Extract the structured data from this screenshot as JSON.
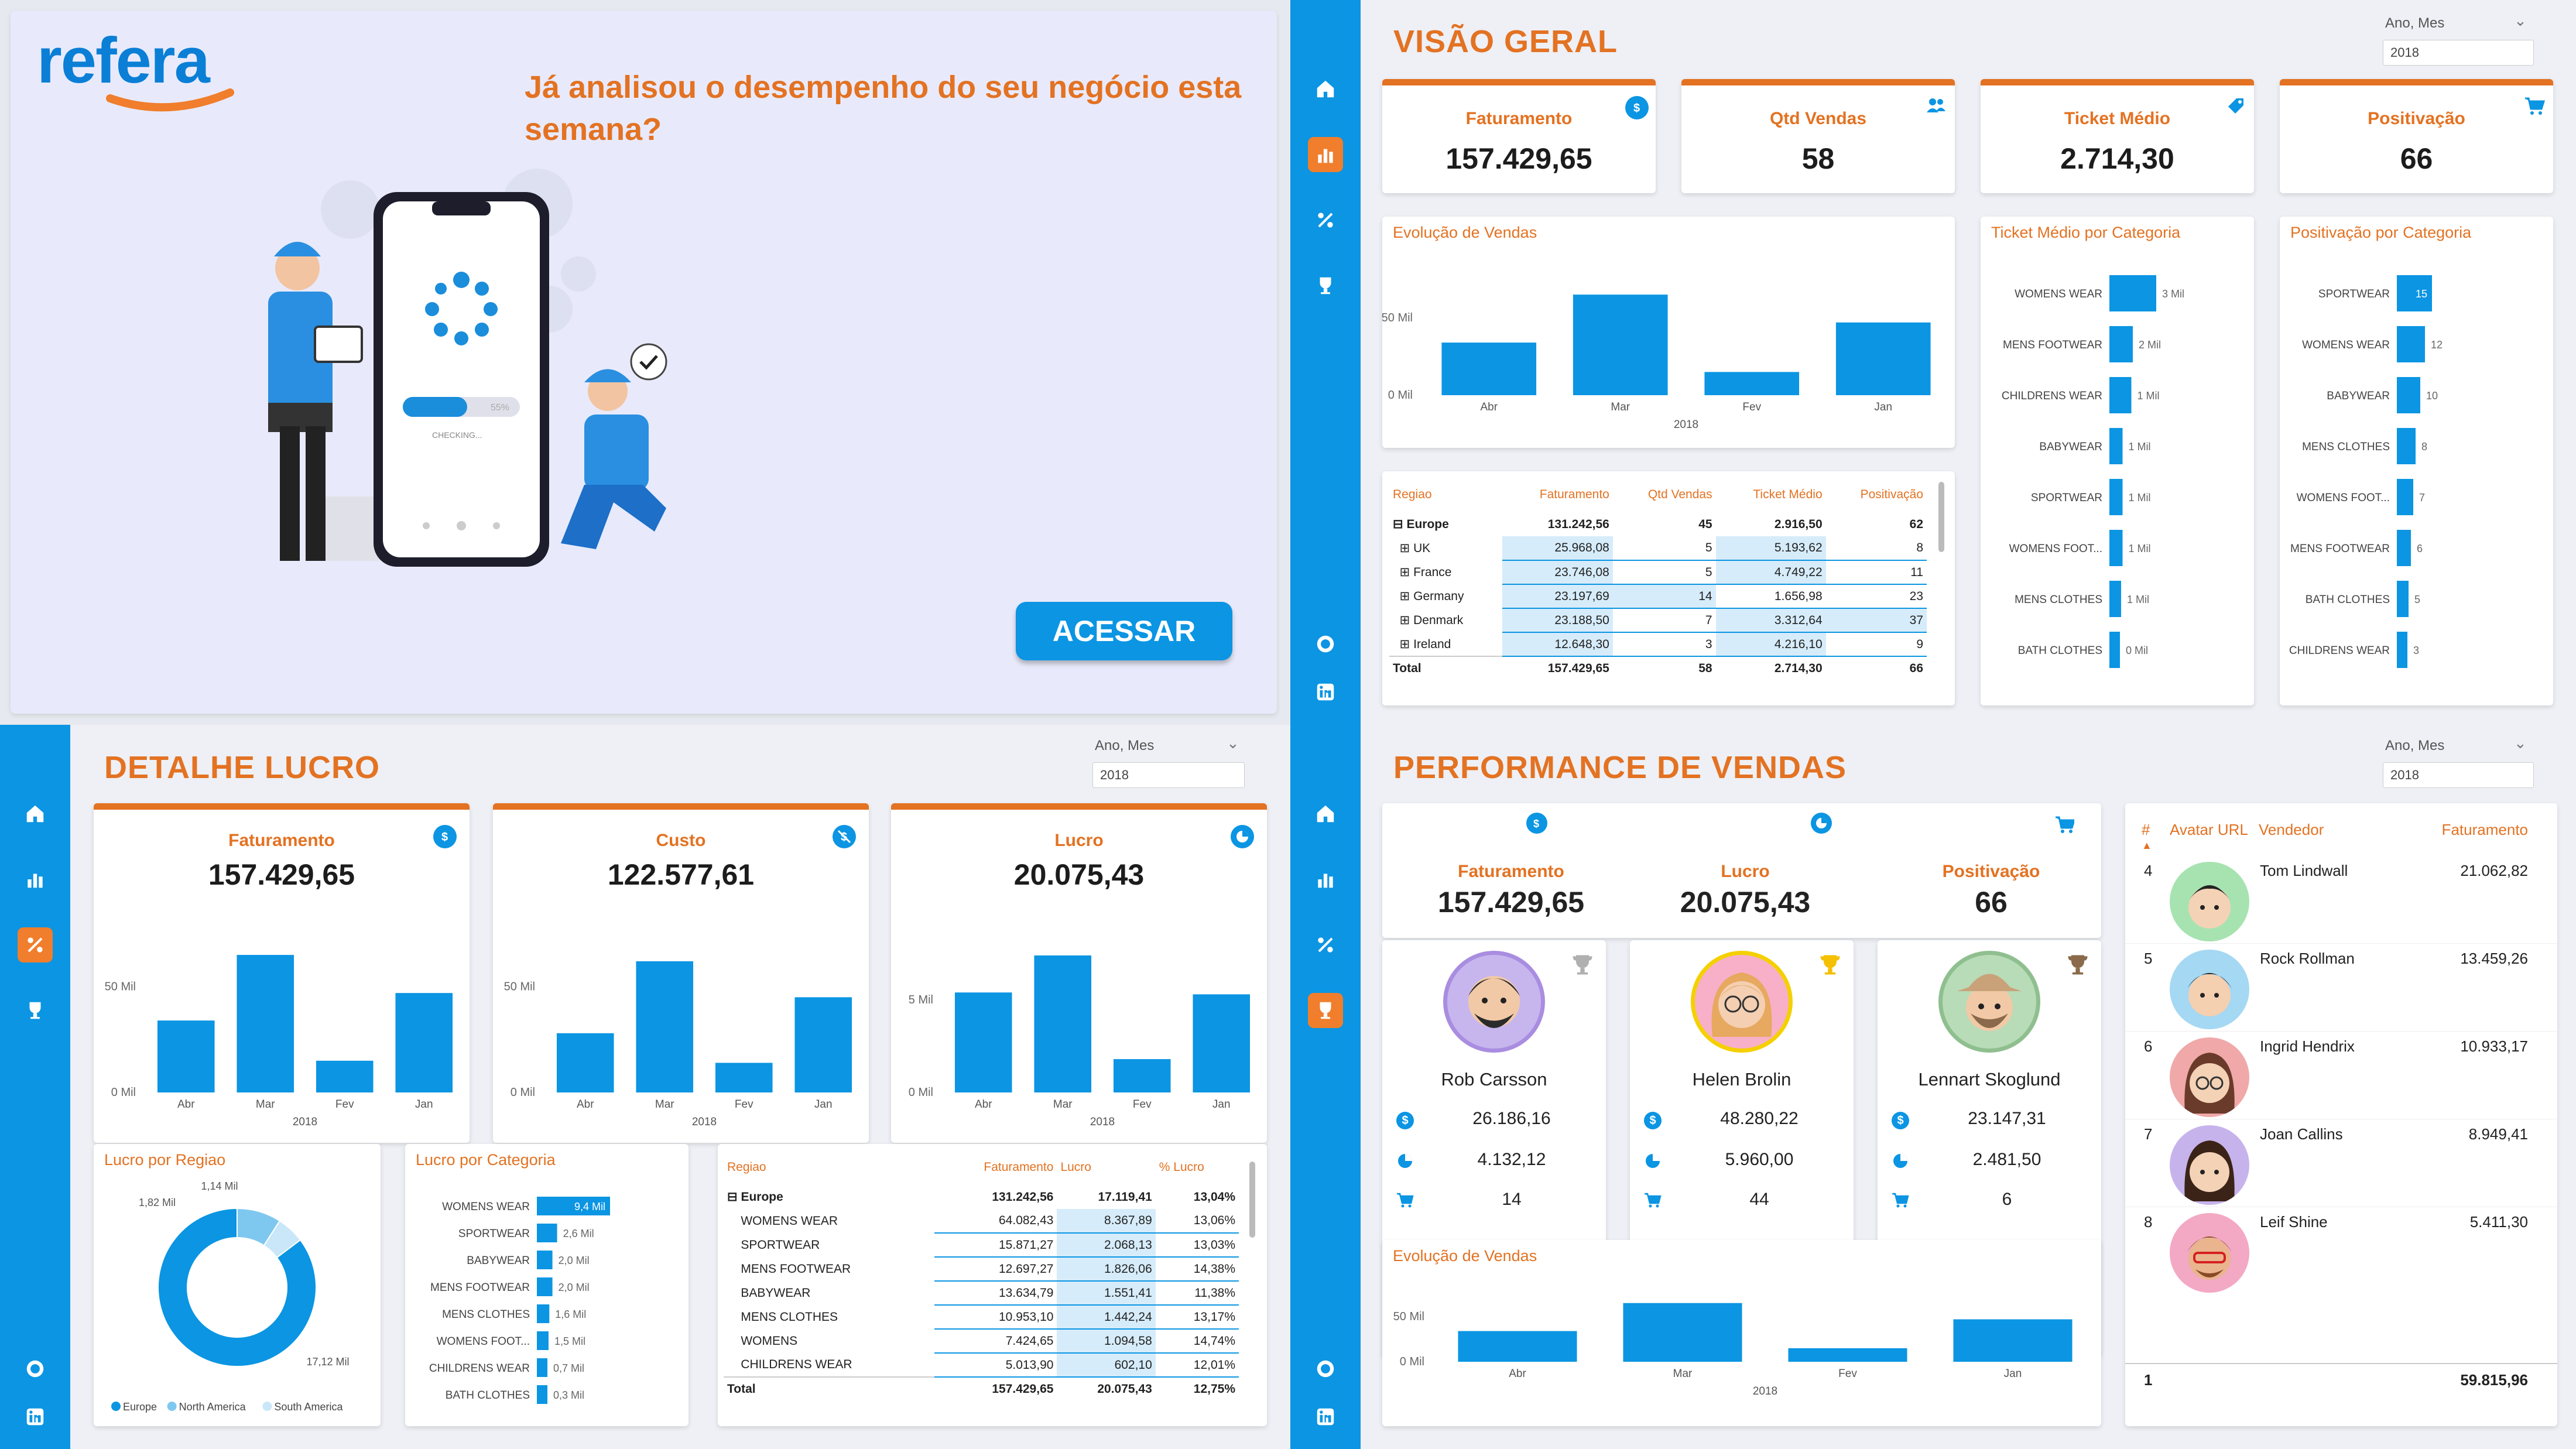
{
  "sidebar_icons": [
    "home-icon",
    "bar-chart-icon",
    "percent-icon",
    "trophy-icon",
    "github-icon",
    "linkedin-icon"
  ],
  "colors": {
    "accent": "#e37222",
    "primary": "#0b95e3",
    "background": "#e6e9ef"
  },
  "welcome": {
    "logo": "refera",
    "headline": "Já analisou o desempenho do seu negócio esta semana?",
    "phone_progress": "55%",
    "phone_status": "CHECKING...",
    "button": "ACESSAR"
  },
  "visao_geral": {
    "title": "VISÃO GERAL",
    "filter_label": "Ano, Mes",
    "filter_value": "2018",
    "kpis": [
      {
        "label": "Faturamento",
        "value": "157.429,65",
        "icon": "dollar-icon"
      },
      {
        "label": "Qtd Vendas",
        "value": "58",
        "icon": "people-icon"
      },
      {
        "label": "Ticket Médio",
        "value": "2.714,30",
        "icon": "tag-icon"
      },
      {
        "label": "Positivação",
        "value": "66",
        "icon": "cart-icon"
      }
    ],
    "evolucao_title": "Evolução de Vendas",
    "ticket_title": "Ticket Médio por Categoria",
    "posit_title": "Positivação por Categoria",
    "table": {
      "headers": [
        "Regiao",
        "Faturamento",
        "Qtd Vendas",
        "Ticket Médio",
        "Positivação"
      ],
      "rows": [
        {
          "name": "Europe",
          "fat": "131.242,56",
          "qtd": "45",
          "tm": "2.916,50",
          "pos": "62",
          "bold": true
        },
        {
          "name": "UK",
          "fat": "25.968,08",
          "qtd": "5",
          "tm": "5.193,62",
          "pos": "8"
        },
        {
          "name": "France",
          "fat": "23.746,08",
          "qtd": "5",
          "tm": "4.749,22",
          "pos": "11"
        },
        {
          "name": "Germany",
          "fat": "23.197,69",
          "qtd": "14",
          "tm": "1.656,98",
          "pos": "23"
        },
        {
          "name": "Denmark",
          "fat": "23.188,50",
          "qtd": "7",
          "tm": "3.312,64",
          "pos": "37"
        },
        {
          "name": "Ireland",
          "fat": "12.648,30",
          "qtd": "3",
          "tm": "4.216,10",
          "pos": "9"
        }
      ],
      "total": {
        "name": "Total",
        "fat": "157.429,65",
        "qtd": "58",
        "tm": "2.714,30",
        "pos": "66"
      }
    }
  },
  "detalhe_lucro": {
    "title": "DETALHE LUCRO",
    "filter_label": "Ano, Mes",
    "filter_value": "2018",
    "kpis": [
      {
        "label": "Faturamento",
        "value": "157.429,65",
        "icon": "dollar-icon"
      },
      {
        "label": "Custo",
        "value": "122.577,61",
        "icon": "no-dollar-icon"
      },
      {
        "label": "Lucro",
        "value": "20.075,43",
        "icon": "pie-icon"
      }
    ],
    "regiao_title": "Lucro por Regiao",
    "categoria_title": "Lucro por Categoria",
    "table": {
      "headers": [
        "Regiao",
        "Faturamento",
        "Lucro",
        "% Lucro"
      ],
      "rows": [
        {
          "name": "Europe",
          "fat": "131.242,56",
          "lucro": "17.119,41",
          "pct": "13,04%",
          "bold": true
        },
        {
          "name": "WOMENS WEAR",
          "fat": "64.082,43",
          "lucro": "8.367,89",
          "pct": "13,06%"
        },
        {
          "name": "SPORTWEAR",
          "fat": "15.871,27",
          "lucro": "2.068,13",
          "pct": "13,03%"
        },
        {
          "name": "MENS FOOTWEAR",
          "fat": "12.697,27",
          "lucro": "1.826,06",
          "pct": "14,38%"
        },
        {
          "name": "BABYWEAR",
          "fat": "13.634,79",
          "lucro": "1.551,41",
          "pct": "11,38%"
        },
        {
          "name": "MENS CLOTHES",
          "fat": "10.953,10",
          "lucro": "1.442,24",
          "pct": "13,17%"
        },
        {
          "name": "WOMENS",
          "fat": "7.424,65",
          "lucro": "1.094,58",
          "pct": "14,74%"
        },
        {
          "name": "CHILDRENS WEAR",
          "fat": "5.013,90",
          "lucro": "602,10",
          "pct": "12,01%"
        }
      ],
      "total": {
        "name": "Total",
        "fat": "157.429,65",
        "lucro": "20.075,43",
        "pct": "12,75%"
      }
    }
  },
  "performance": {
    "title": "PERFORMANCE DE VENDAS",
    "filter_label": "Ano, Mes",
    "filter_value": "2018",
    "kpis": [
      {
        "label": "Faturamento",
        "value": "157.429,65",
        "icon": "dollar-icon"
      },
      {
        "label": "Lucro",
        "value": "20.075,43",
        "icon": "pie-icon"
      },
      {
        "label": "Positivação",
        "value": "66",
        "icon": "cart-icon"
      }
    ],
    "top3": [
      {
        "name": "Rob Carsson",
        "fat": "26.186,16",
        "lucro": "4.132,12",
        "pos": "14",
        "ring": "#a98de0",
        "trophy": "#b0b0b0"
      },
      {
        "name": "Helen Brolin",
        "fat": "48.280,22",
        "lucro": "5.960,00",
        "pos": "44",
        "ring": "#f5d000",
        "trophy": "#f5c000"
      },
      {
        "name": "Lennart Skoglund",
        "fat": "23.147,31",
        "lucro": "2.481,50",
        "pos": "6",
        "ring": "#8fbf8f",
        "trophy": "#8a6a4a"
      }
    ],
    "evolucao_title": "Evolução de Vendas",
    "ranking": {
      "headers": [
        "#",
        "Avatar URL",
        "Vendedor",
        "Faturamento"
      ],
      "rows": [
        {
          "pos": "4",
          "name": "Tom Lindwall",
          "fat": "21.062,82",
          "bg": "#a7e3b0"
        },
        {
          "pos": "5",
          "name": "Rock Rollman",
          "fat": "13.459,26",
          "bg": "#a5d8f3"
        },
        {
          "pos": "6",
          "name": "Ingrid Hendrix",
          "fat": "10.933,17",
          "bg": "#f0a8a8"
        },
        {
          "pos": "7",
          "name": "Joan Callins",
          "fat": "8.949,41",
          "bg": "#c6b3ec"
        },
        {
          "pos": "8",
          "name": "Leif Shine",
          "fat": "5.411,30",
          "bg": "#f3a8c4"
        }
      ],
      "total_pos": "1",
      "total_fat": "59.815,96"
    }
  },
  "chart_data": [
    {
      "id": "vg-evolucao",
      "type": "bar",
      "title": "Evolução de Vendas",
      "categories": [
        "Abr",
        "Mar",
        "Fev",
        "Jan"
      ],
      "xgroup": "2018",
      "values": [
        34,
        65,
        15,
        47
      ],
      "yticks": [
        "50 Mil",
        "0 Mil"
      ],
      "tickvals": [
        50,
        0
      ],
      "ymax": 70
    },
    {
      "id": "vg-ticket",
      "type": "bar",
      "orientation": "horizontal",
      "title": "Ticket Médio por Categoria",
      "categories": [
        "WOMENS WEAR",
        "MENS FOOTWEAR",
        "CHILDRENS WEAR",
        "BABYWEAR",
        "SPORTWEAR",
        "WOMENS FOOT...",
        "MENS CLOTHES",
        "BATH CLOTHES"
      ],
      "values": [
        3,
        2,
        1,
        1,
        1,
        1,
        1,
        0
      ],
      "bar_values": [
        3.2,
        1.6,
        1.5,
        0.9,
        0.9,
        0.9,
        0.8,
        0.2
      ],
      "labels": [
        "3 Mil",
        "2 Mil",
        "1 Mil",
        "1 Mil",
        "1 Mil",
        "1 Mil",
        "1 Mil",
        "0 Mil"
      ]
    },
    {
      "id": "vg-posit",
      "type": "bar",
      "orientation": "horizontal",
      "title": "Positivação por Categoria",
      "categories": [
        "SPORTWEAR",
        "WOMENS WEAR",
        "BABYWEAR",
        "MENS CLOTHES",
        "WOMENS FOOT...",
        "MENS FOOTWEAR",
        "BATH CLOTHES",
        "CHILDRENS WEAR"
      ],
      "values": [
        15,
        12,
        10,
        8,
        7,
        6,
        5,
        3
      ],
      "labels": [
        "15",
        "12",
        "10",
        "8",
        "7",
        "6",
        "5",
        "3"
      ]
    },
    {
      "id": "dl-fat",
      "type": "bar",
      "categories": [
        "Abr",
        "Mar",
        "Fev",
        "Jan"
      ],
      "xgroup": "2018",
      "values": [
        34,
        65,
        15,
        47
      ],
      "yticks": [
        "50 Mil",
        "0 Mil"
      ],
      "tickvals": [
        50,
        0
      ],
      "ymax": 70
    },
    {
      "id": "dl-custo",
      "type": "bar",
      "categories": [
        "Abr",
        "Mar",
        "Fev",
        "Jan"
      ],
      "xgroup": "2018",
      "values": [
        28,
        62,
        14,
        45
      ],
      "yticks": [
        "50 Mil",
        "0 Mil"
      ],
      "tickvals": [
        50,
        0
      ],
      "ymax": 70
    },
    {
      "id": "dl-lucro",
      "type": "bar",
      "categories": [
        "Abr",
        "Mar",
        "Fev",
        "Jan"
      ],
      "xgroup": "2018",
      "values": [
        5.4,
        7.4,
        1.8,
        5.3
      ],
      "yticks": [
        "5 Mil",
        "0 Mil"
      ],
      "tickvals": [
        5,
        0
      ],
      "ymax": 8
    },
    {
      "id": "dl-regiao",
      "type": "pie",
      "title": "Lucro por Regiao",
      "categories": [
        "Europe",
        "North America",
        "South America"
      ],
      "values": [
        17.12,
        1.82,
        1.14
      ],
      "labels": [
        "17,12 Mil",
        "1,82 Mil",
        "1,14 Mil"
      ],
      "colors": [
        "#0b95e3",
        "#7ec8f0",
        "#c9e7f8"
      ]
    },
    {
      "id": "dl-categoria",
      "type": "bar",
      "orientation": "horizontal",
      "title": "Lucro por Categoria",
      "categories": [
        "WOMENS WEAR",
        "SPORTWEAR",
        "BABYWEAR",
        "MENS FOOTWEAR",
        "MENS CLOTHES",
        "WOMENS FOOT...",
        "CHILDRENS WEAR",
        "BATH CLOTHES"
      ],
      "values": [
        9.4,
        2.6,
        2.0,
        2.0,
        1.6,
        1.5,
        0.7,
        0.3
      ],
      "labels": [
        "9,4 Mil",
        "2,6 Mil",
        "2,0 Mil",
        "2,0 Mil",
        "1,6 Mil",
        "1,5 Mil",
        "0,7 Mil",
        "0,3 Mil"
      ]
    },
    {
      "id": "pv-evolucao",
      "type": "bar",
      "title": "Evolução de Vendas",
      "categories": [
        "Abr",
        "Mar",
        "Fev",
        "Jan"
      ],
      "xgroup": "2018",
      "values": [
        34,
        65,
        15,
        47
      ],
      "yticks": [
        "50 Mil",
        "0 Mil"
      ],
      "tickvals": [
        50,
        0
      ],
      "ymax": 70
    }
  ]
}
